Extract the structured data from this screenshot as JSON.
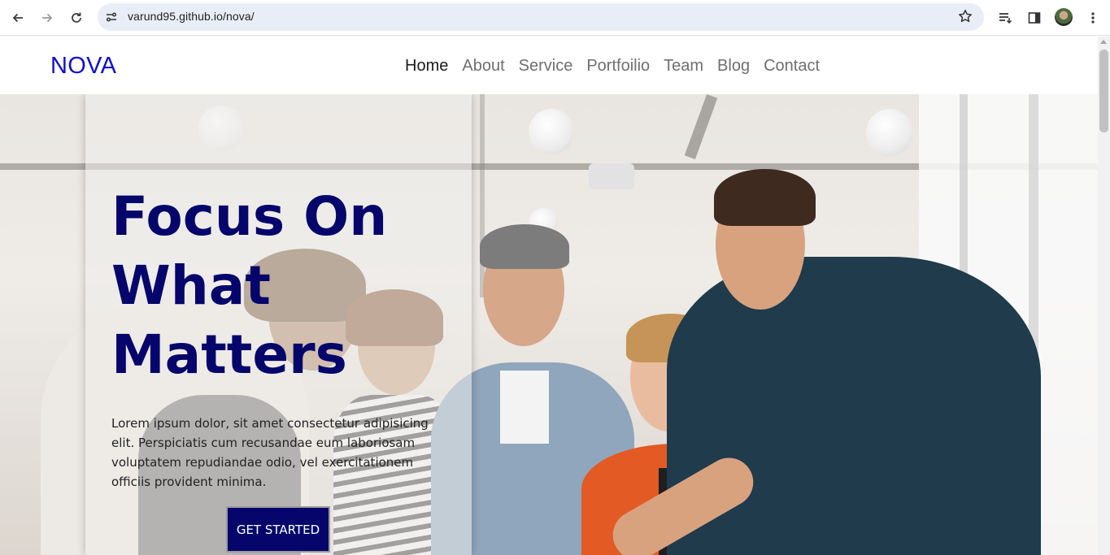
{
  "browser": {
    "url": "varund95.github.io/nova/",
    "icons": [
      "back-arrow-icon",
      "forward-arrow-icon",
      "reload-icon",
      "site-settings-icon",
      "bookmark-star-icon",
      "reading-list-icon",
      "side-panel-icon",
      "profile-avatar",
      "kebab-menu-icon"
    ]
  },
  "nav": {
    "brand": "NOVA",
    "items": [
      {
        "label": "Home",
        "active": true
      },
      {
        "label": "About"
      },
      {
        "label": "Service"
      },
      {
        "label": "Portfoilio"
      },
      {
        "label": "Team"
      },
      {
        "label": "Blog"
      },
      {
        "label": "Contact"
      }
    ]
  },
  "hero": {
    "headline_lines": [
      "Focus On",
      "What",
      "Matters"
    ],
    "lead": "Lorem ipsum dolor, sit amet consectetur adipisicing elit. Perspiciatis cum recusandae eum laboriosam voluptatem repudiandae odio, vel exercitationem officiis provident minima.",
    "cta_label": "GET STARTED"
  },
  "colors": {
    "brand": "#0e0ecc",
    "headline": "#05056b",
    "cta_bg": "#05056b"
  }
}
